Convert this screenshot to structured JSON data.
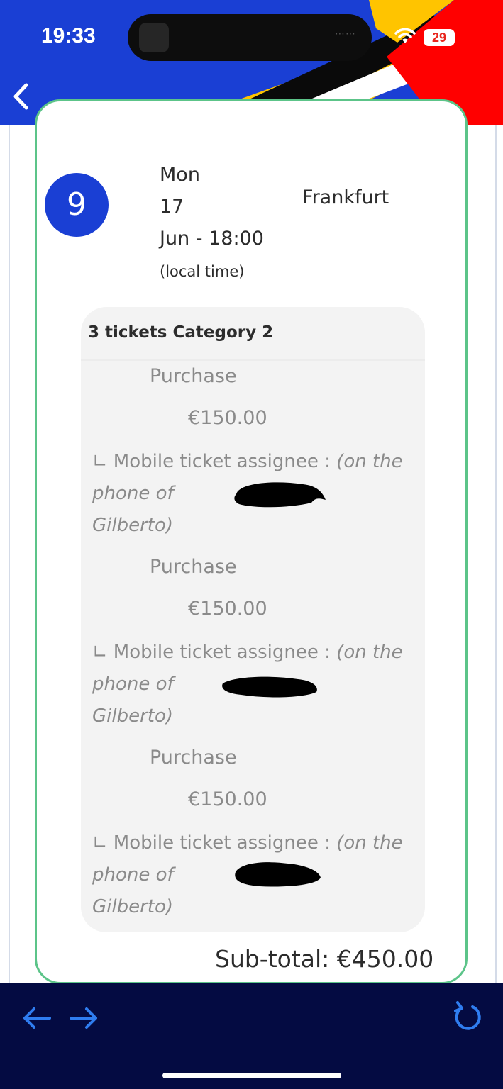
{
  "status_bar": {
    "time": "19:33",
    "battery": "29",
    "battery_color": "#e8271e",
    "wifi_icon": "wifi-icon"
  },
  "header": {
    "back_icon": "chevron-left-icon",
    "background_color": "#1a3fd4"
  },
  "match": {
    "number": "9",
    "day": "Mon",
    "date": "17",
    "month_time": "Jun - 18:00",
    "time_note": "(local time)",
    "venue": "Frankfurt"
  },
  "tickets": {
    "title": "3 tickets Category 2",
    "items": [
      {
        "type": "Purchase",
        "price": "€150.00",
        "assignee_label": "Mobile ticket assignee :",
        "assignee_prefix": "(on the phone of",
        "assignee_suffix": "Gilberto)"
      },
      {
        "type": "Purchase",
        "price": "€150.00",
        "assignee_label": "Mobile ticket assignee :",
        "assignee_prefix": "(on the phone of",
        "assignee_suffix": "Gilberto)"
      },
      {
        "type": "Purchase",
        "price": "€150.00",
        "assignee_label": "Mobile ticket assignee :",
        "assignee_prefix": "(on the phone of",
        "assignee_suffix": "Gilberto)"
      }
    ]
  },
  "subtotal": "Sub-total: €450.00",
  "bottom_nav": {
    "back_icon": "arrow-left-icon",
    "forward_icon": "arrow-right-icon",
    "reload_icon": "reload-icon",
    "accent_color": "#2f7df0"
  },
  "colors": {
    "card_border": "#5cc489",
    "bottom_bar": "#040b42"
  }
}
